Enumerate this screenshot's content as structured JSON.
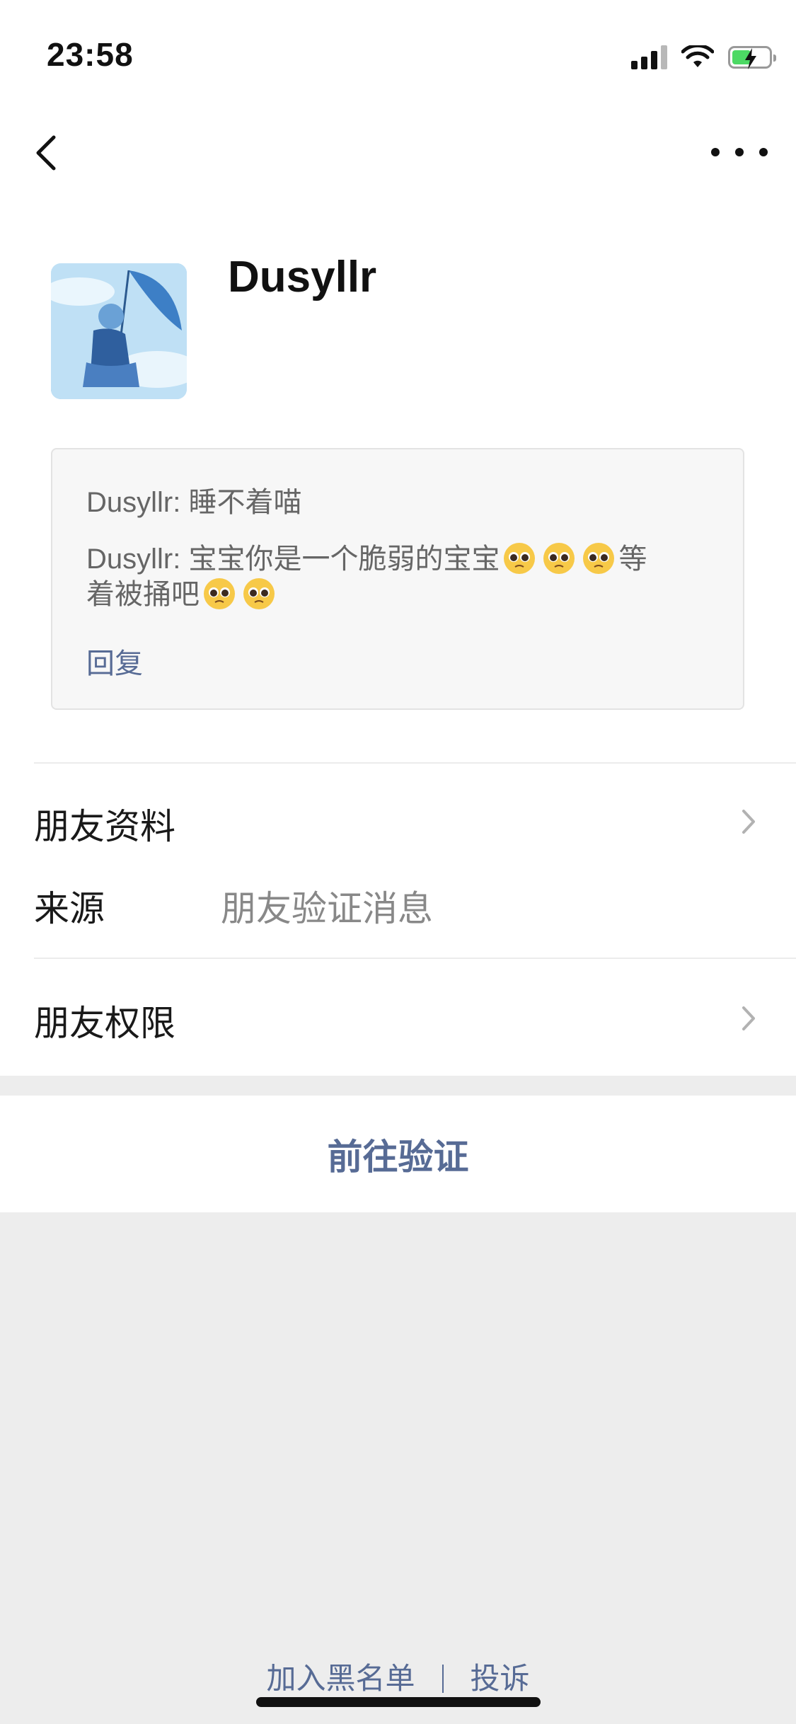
{
  "status_bar": {
    "time": "23:58",
    "icons": [
      "signal-icon",
      "wifi-icon",
      "battery-charging-icon"
    ]
  },
  "nav": {
    "back_icon": "chevron-left-icon",
    "more_icon": "more-dots-icon"
  },
  "profile": {
    "nickname": "Dusyllr"
  },
  "messages": [
    {
      "sender": "Dusyllr: ",
      "text": "睡不着喵",
      "emoji_count": 0
    },
    {
      "sender": "Dusyllr: ",
      "text_before": "宝宝你是一个脆弱的宝宝",
      "text_mid": "等",
      "text_line2": "着被捅吧",
      "emoji": "pleading-face"
    }
  ],
  "reply_label": "回复",
  "rows": {
    "friend_profile": {
      "label": "朋友资料"
    },
    "source": {
      "label": "来源",
      "value": "朋友验证消息"
    },
    "friend_permissions": {
      "label": "朋友权限"
    }
  },
  "verify_button": "前往验证",
  "footer": {
    "blacklist": "加入黑名单",
    "report": "投诉"
  },
  "colors": {
    "link_blue": "#576b95",
    "background_gray": "#ededed",
    "battery_green": "#4cd964"
  }
}
